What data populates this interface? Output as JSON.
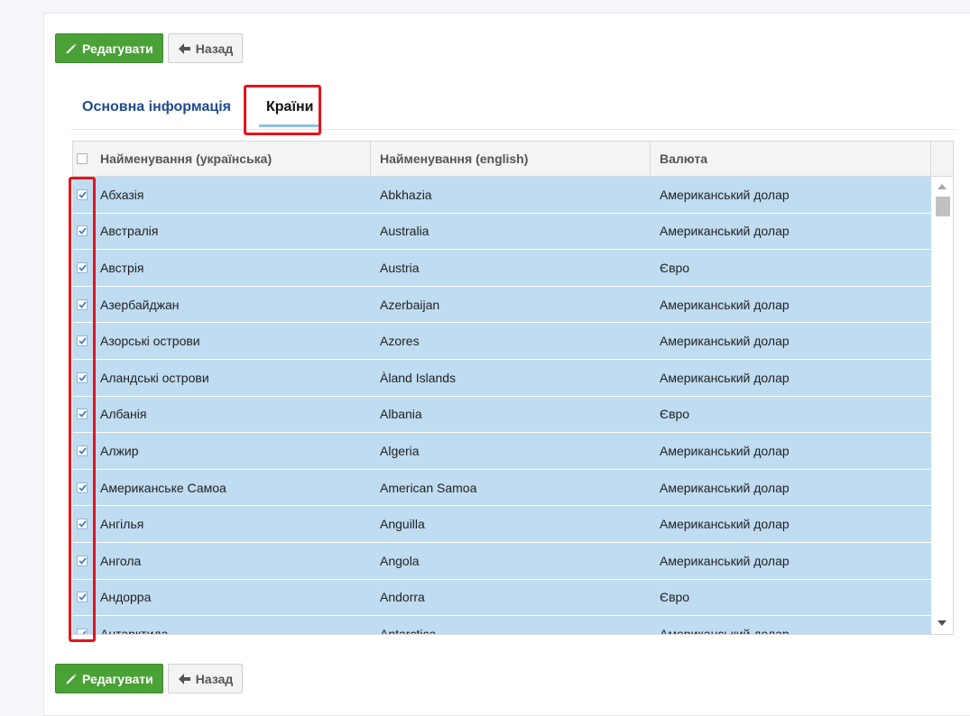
{
  "toolbar": {
    "edit_label": "Редагувати",
    "back_label": "Назад"
  },
  "tabs": [
    {
      "label": "Основна інформація",
      "active": false
    },
    {
      "label": "Країни",
      "active": true
    }
  ],
  "grid": {
    "columns": [
      "Найменування (українська)",
      "Найменування (english)",
      "Валюта"
    ],
    "rows": [
      {
        "ua": "Абхазія",
        "en": "Abkhazia",
        "currency": "Американський долар",
        "checked": true
      },
      {
        "ua": "Австралія",
        "en": "Australia",
        "currency": "Американський долар",
        "checked": true
      },
      {
        "ua": "Австрія",
        "en": "Austria",
        "currency": "Євро",
        "checked": true
      },
      {
        "ua": "Азербайджан",
        "en": "Azerbaijan",
        "currency": "Американський долар",
        "checked": true
      },
      {
        "ua": "Азорські острови",
        "en": "Azores",
        "currency": "Американський долар",
        "checked": true
      },
      {
        "ua": "Аландські острови",
        "en": "Àland Islands",
        "currency": "Американський долар",
        "checked": true
      },
      {
        "ua": "Албанія",
        "en": "Albania",
        "currency": "Євро",
        "checked": true
      },
      {
        "ua": "Алжир",
        "en": "Algeria",
        "currency": "Американський долар",
        "checked": true
      },
      {
        "ua": "Американське Самоа",
        "en": "American Samoa",
        "currency": "Американський долар",
        "checked": true
      },
      {
        "ua": "Ангілья",
        "en": "Anguilla",
        "currency": "Американський долар",
        "checked": true
      },
      {
        "ua": "Ангола",
        "en": "Angola",
        "currency": "Американський долар",
        "checked": true
      },
      {
        "ua": "Андорра",
        "en": "Andorra",
        "currency": "Євро",
        "checked": true
      },
      {
        "ua": "Антарктида",
        "en": "Antarctica",
        "currency": "Американський долар",
        "checked": true
      }
    ]
  },
  "colors": {
    "accent_green": "#4aa136",
    "row_selected": "#bfdcf1",
    "tab_link": "#1f4b8e",
    "highlight_red": "#e8131b"
  },
  "icons": {
    "edit": "pencil-icon",
    "back": "arrow-left-icon",
    "check": "checkmark-icon"
  }
}
